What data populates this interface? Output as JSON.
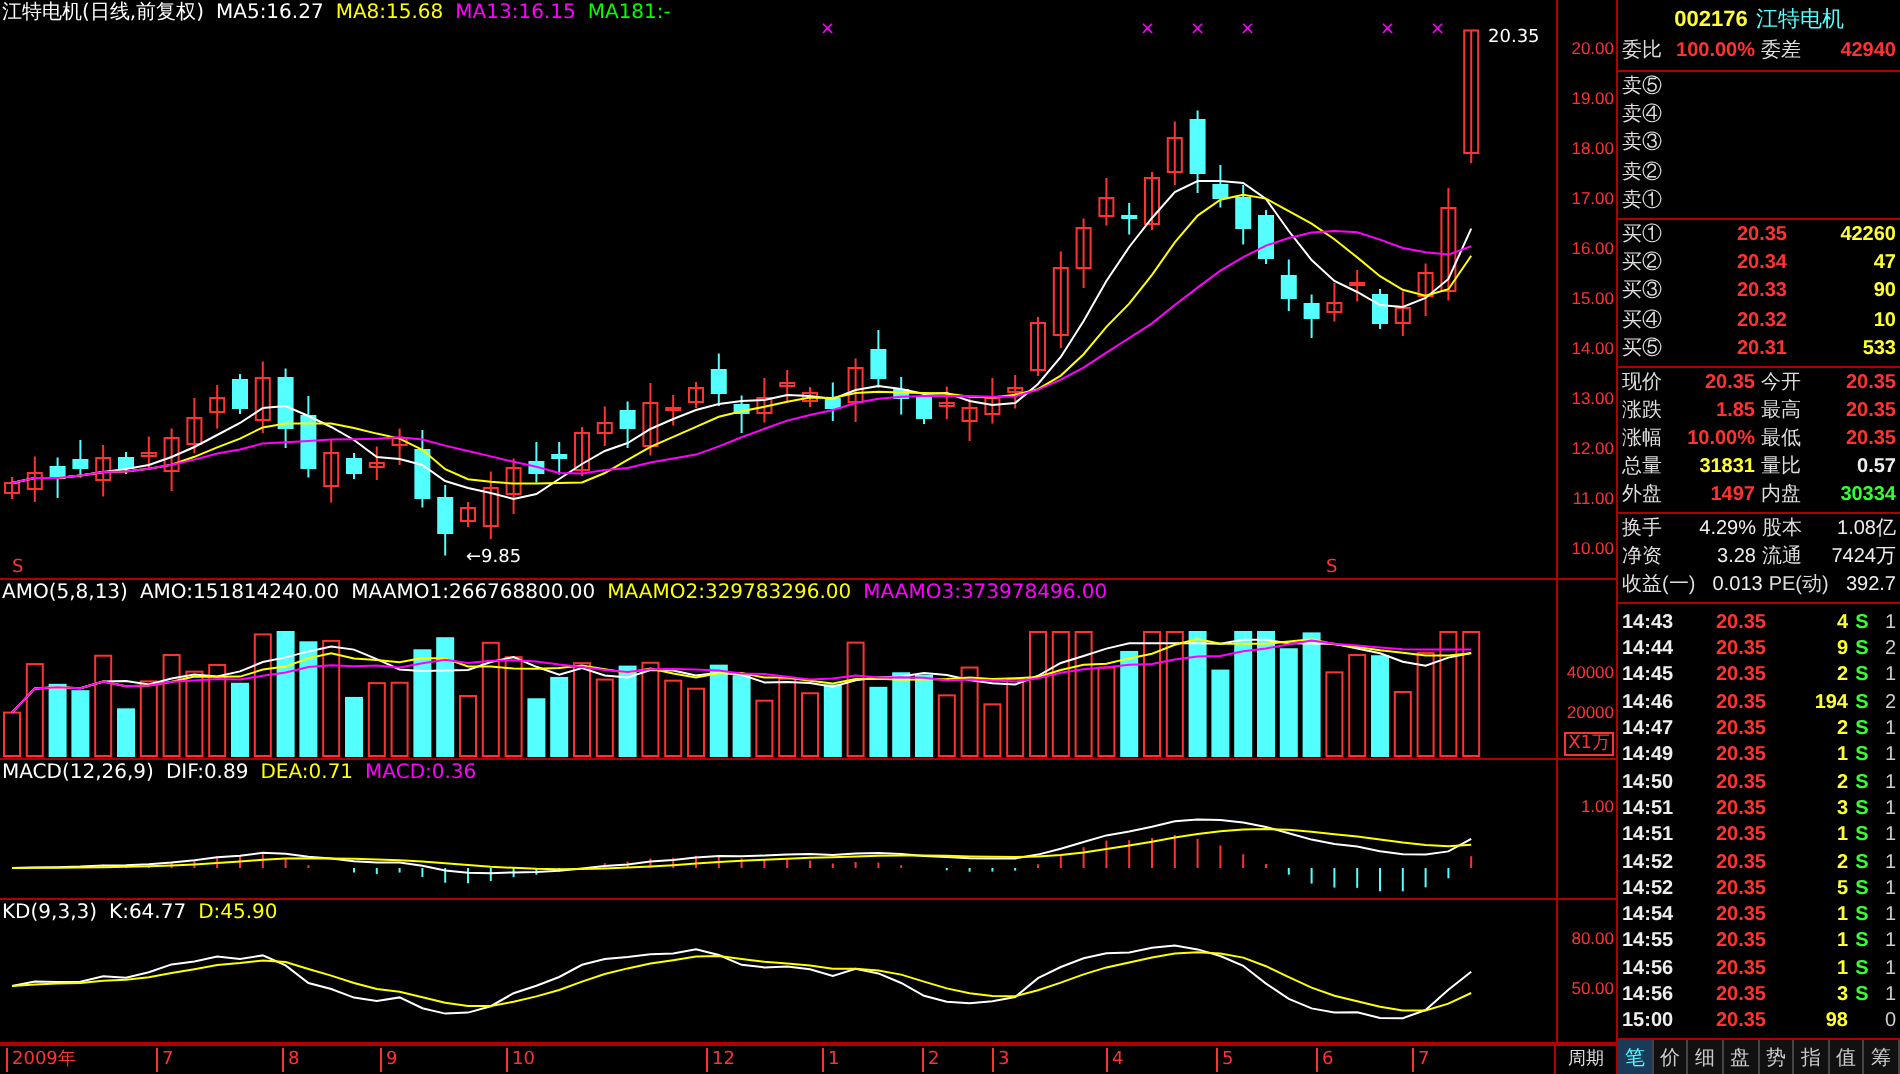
{
  "price_panel": {
    "title": "江特电机(日线,前复权)",
    "indicators": [
      {
        "label": "MA5:16.27",
        "color": "#ffffff"
      },
      {
        "label": "MA8:15.68",
        "color": "#ffff00"
      },
      {
        "label": "MA13:16.15",
        "color": "#ff00ff"
      },
      {
        "label": "MA181:-",
        "color": "#00ff00"
      }
    ],
    "marks": [
      "×",
      "×",
      "×",
      "×",
      "×",
      "×"
    ],
    "high_label": "20.35",
    "low_label": "←9.85",
    "signals": [
      "S",
      "S"
    ],
    "axis": [
      "20.00",
      "19.00",
      "18.00",
      "17.00",
      "16.00",
      "15.00",
      "14.00",
      "13.00",
      "12.00",
      "11.00",
      "10.00"
    ]
  },
  "amo_panel": {
    "indicators": [
      {
        "label": "AMO(5,8,13)",
        "color": "#ffffff"
      },
      {
        "label": "AMO:151814240.00",
        "color": "#ffffff"
      },
      {
        "label": "MAAMO1:266768800.00",
        "color": "#ffffff"
      },
      {
        "label": "MAAMO2:329783296.00",
        "color": "#ffff00"
      },
      {
        "label": "MAAMO3:373978496.00",
        "color": "#ff00ff"
      }
    ],
    "axis": [
      "40000",
      "20000"
    ],
    "unit": "X1万"
  },
  "macd_panel": {
    "indicators": [
      {
        "label": "MACD(12,26,9)",
        "color": "#ffffff"
      },
      {
        "label": "DIF:0.89",
        "color": "#ffffff"
      },
      {
        "label": "DEA:0.71",
        "color": "#ffff00"
      },
      {
        "label": "MACD:0.36",
        "color": "#ff00ff"
      }
    ],
    "axis": [
      "1.00"
    ]
  },
  "kd_panel": {
    "indicators": [
      {
        "label": "KD(9,3,3)",
        "color": "#ffffff"
      },
      {
        "label": "K:64.77",
        "color": "#ffffff"
      },
      {
        "label": "D:45.90",
        "color": "#ffff00"
      }
    ],
    "axis": [
      "80.00",
      "50.00"
    ]
  },
  "x_axis": [
    "2009年",
    "7",
    "8",
    "9",
    "10",
    "12",
    "1",
    "2",
    "3",
    "4",
    "5",
    "6",
    "7"
  ],
  "period_label": "周期",
  "quote": {
    "code": "002176",
    "name": "江特电机",
    "ratio": {
      "label": "委比",
      "value": "100.00%",
      "label2": "委差",
      "value2": "42940"
    },
    "asks": [
      {
        "label": "卖⑤"
      },
      {
        "label": "卖④"
      },
      {
        "label": "卖③"
      },
      {
        "label": "卖②"
      },
      {
        "label": "卖①"
      }
    ],
    "bids": [
      {
        "label": "买①",
        "price": "20.35",
        "volume": "42260"
      },
      {
        "label": "买②",
        "price": "20.34",
        "volume": "47"
      },
      {
        "label": "买③",
        "price": "20.33",
        "volume": "90"
      },
      {
        "label": "买④",
        "price": "20.32",
        "volume": "10"
      },
      {
        "label": "买⑤",
        "price": "20.31",
        "volume": "533"
      }
    ],
    "stats": [
      {
        "cells": [
          {
            "label": "现价",
            "value": "20.35",
            "color": "#ff3232"
          },
          {
            "label": "今开",
            "value": "20.35",
            "color": "#ff3232"
          }
        ]
      },
      {
        "cells": [
          {
            "label": "涨跌",
            "value": "1.85",
            "color": "#ff3232"
          },
          {
            "label": "最高",
            "value": "20.35",
            "color": "#ff3232"
          }
        ]
      },
      {
        "cells": [
          {
            "label": "涨幅",
            "value": "10.00%",
            "color": "#ff3232"
          },
          {
            "label": "最低",
            "value": "20.35",
            "color": "#ff3232"
          }
        ]
      },
      {
        "cells": [
          {
            "label": "总量",
            "value": "31831",
            "color": "#ffff33"
          },
          {
            "label": "量比",
            "value": "0.57",
            "color": "#eeeeee"
          }
        ]
      },
      {
        "cells": [
          {
            "label": "外盘",
            "value": "1497",
            "color": "#ff3232"
          },
          {
            "label": "内盘",
            "value": "30334",
            "color": "#33ff33"
          }
        ]
      }
    ],
    "fundamentals": [
      {
        "label": "换手",
        "value": "4.29%",
        "label2": "股本",
        "value2": "1.08亿"
      },
      {
        "label": "净资",
        "value": "3.28",
        "label2": "流通",
        "value2": "7424万"
      },
      {
        "label": "收益(一)",
        "value": "0.013",
        "label2": "PE(动)",
        "value2": "392.7"
      }
    ],
    "ticks": [
      {
        "time": "14:43",
        "price": "20.35",
        "volume": "4",
        "side": "S",
        "count": "1"
      },
      {
        "time": "14:44",
        "price": "20.35",
        "volume": "9",
        "side": "S",
        "count": "2"
      },
      {
        "time": "14:45",
        "price": "20.35",
        "volume": "2",
        "side": "S",
        "count": "1"
      },
      {
        "time": "14:46",
        "price": "20.35",
        "volume": "194",
        "side": "S",
        "count": "2"
      },
      {
        "time": "14:47",
        "price": "20.35",
        "volume": "2",
        "side": "S",
        "count": "1"
      },
      {
        "time": "14:49",
        "price": "20.35",
        "volume": "1",
        "side": "S",
        "count": "1"
      },
      {
        "time": "14:50",
        "price": "20.35",
        "volume": "2",
        "side": "S",
        "count": "1"
      },
      {
        "time": "14:51",
        "price": "20.35",
        "volume": "3",
        "side": "S",
        "count": "1"
      },
      {
        "time": "14:51",
        "price": "20.35",
        "volume": "1",
        "side": "S",
        "count": "1"
      },
      {
        "time": "14:52",
        "price": "20.35",
        "volume": "2",
        "side": "S",
        "count": "1"
      },
      {
        "time": "14:52",
        "price": "20.35",
        "volume": "5",
        "side": "S",
        "count": "1"
      },
      {
        "time": "14:54",
        "price": "20.35",
        "volume": "1",
        "side": "S",
        "count": "1"
      },
      {
        "time": "14:55",
        "price": "20.35",
        "volume": "1",
        "side": "S",
        "count": "1"
      },
      {
        "time": "14:56",
        "price": "20.35",
        "volume": "1",
        "side": "S",
        "count": "1"
      },
      {
        "time": "14:56",
        "price": "20.35",
        "volume": "3",
        "side": "S",
        "count": "1"
      },
      {
        "time": "15:00",
        "price": "20.35",
        "volume": "98",
        "count": "0"
      }
    ]
  },
  "tabs": [
    {
      "label": "笔",
      "selected": true
    },
    {
      "label": "价",
      "selected": false
    },
    {
      "label": "细",
      "selected": false
    },
    {
      "label": "盘",
      "selected": false
    },
    {
      "label": "势",
      "selected": false
    },
    {
      "label": "指",
      "selected": false
    },
    {
      "label": "值",
      "selected": false
    },
    {
      "label": "筹",
      "selected": false
    }
  ]
}
